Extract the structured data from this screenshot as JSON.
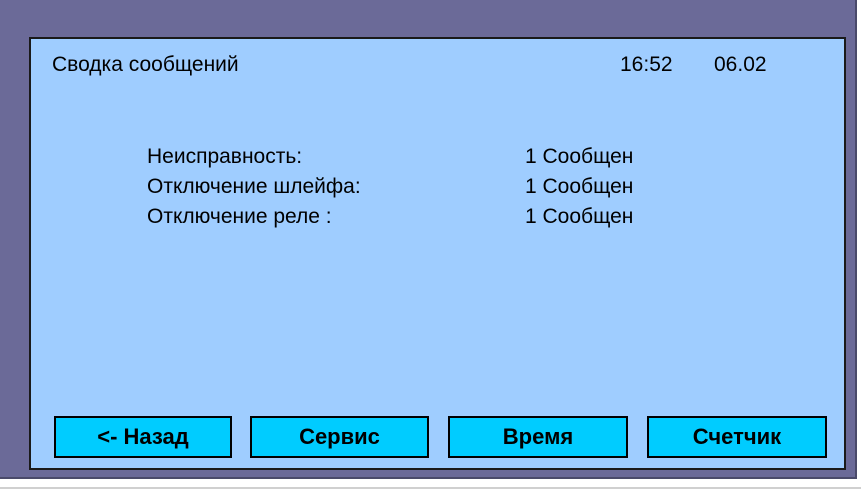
{
  "header": {
    "title": "Сводка сообщений",
    "time": "16:52",
    "date": "06.02"
  },
  "summary": {
    "rows": [
      {
        "label": "Неисправность:",
        "value": "1 Сообщен"
      },
      {
        "label": "Отключение шлейфа:",
        "value": "1 Сообщен"
      },
      {
        "label": "Отключение реле :",
        "value": "1 Сообщен"
      }
    ]
  },
  "buttons": {
    "back": "<- Назад",
    "service": "Сервис",
    "time": "Время",
    "counter": "Счетчик"
  },
  "colors": {
    "frame": "#6b6a98",
    "screen_background": "#9fcdff",
    "button_background": "#00ccff",
    "text": "#000000"
  }
}
